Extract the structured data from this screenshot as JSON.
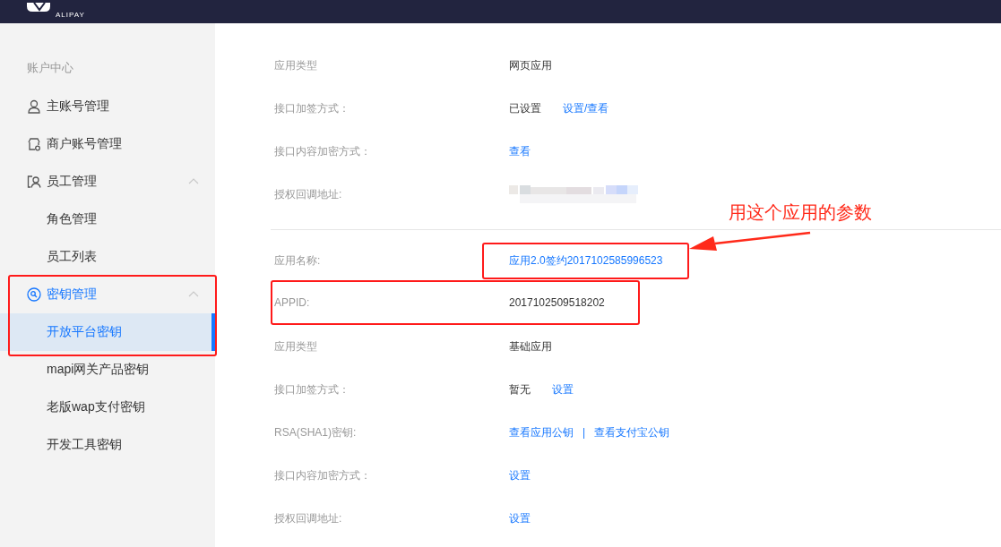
{
  "header": {
    "logo_text": "ALIPAY"
  },
  "sidebar": {
    "section_title": "账户中心",
    "items": [
      {
        "label": "主账号管理",
        "selected": false
      },
      {
        "label": "商户账号管理",
        "selected": false
      },
      {
        "label": "员工管理",
        "expanded": true,
        "selected": false,
        "children": [
          {
            "label": "角色管理",
            "selected": false
          },
          {
            "label": "员工列表",
            "selected": false
          }
        ]
      },
      {
        "label": "密钥管理",
        "expanded": true,
        "selected": true,
        "children": [
          {
            "label": "开放平台密钥",
            "selected": true
          },
          {
            "label": "mapi网关产品密钥",
            "selected": false
          },
          {
            "label": "老版wap支付密钥",
            "selected": false
          },
          {
            "label": "开发工具密钥",
            "selected": false
          }
        ]
      }
    ]
  },
  "sections": [
    {
      "rows": [
        {
          "label": "应用类型",
          "values": [
            {
              "kind": "text",
              "text": "网页应用"
            }
          ]
        },
        {
          "label": "接口加签方式：",
          "values": [
            {
              "kind": "text",
              "text": "已设置"
            },
            {
              "kind": "link",
              "text": "设置/查看"
            }
          ]
        },
        {
          "label": "接口内容加密方式：",
          "values": [
            {
              "kind": "link",
              "text": "查看"
            }
          ]
        },
        {
          "label": "授权回调地址:",
          "values": [
            {
              "kind": "redacted"
            }
          ]
        }
      ]
    },
    {
      "rows": [
        {
          "label": "应用名称:",
          "kind": "boxed_value",
          "values": [
            {
              "kind": "link",
              "text": "应用2.0签约2017102585996523"
            }
          ]
        },
        {
          "label": "APPID:",
          "kind": "boxed_row",
          "values": [
            {
              "kind": "text",
              "text": "2017102509518202"
            }
          ]
        },
        {
          "label": "应用类型",
          "values": [
            {
              "kind": "text",
              "text": "基础应用"
            }
          ]
        },
        {
          "label": "接口加签方式：",
          "values": [
            {
              "kind": "text",
              "text": "暂无"
            },
            {
              "kind": "link",
              "text": "设置"
            }
          ]
        },
        {
          "label": "RSA(SHA1)密钥:",
          "values": [
            {
              "kind": "link",
              "text": "查看应用公钥"
            },
            {
              "kind": "separator",
              "text": "|"
            },
            {
              "kind": "link",
              "text": "查看支付宝公钥"
            }
          ]
        },
        {
          "label": "接口内容加密方式：",
          "values": [
            {
              "kind": "link",
              "text": "设置"
            }
          ]
        },
        {
          "label": "授权回调地址:",
          "values": [
            {
              "kind": "link",
              "text": "设置"
            }
          ]
        }
      ]
    }
  ],
  "annotation": {
    "note": "用这个应用的参数"
  }
}
